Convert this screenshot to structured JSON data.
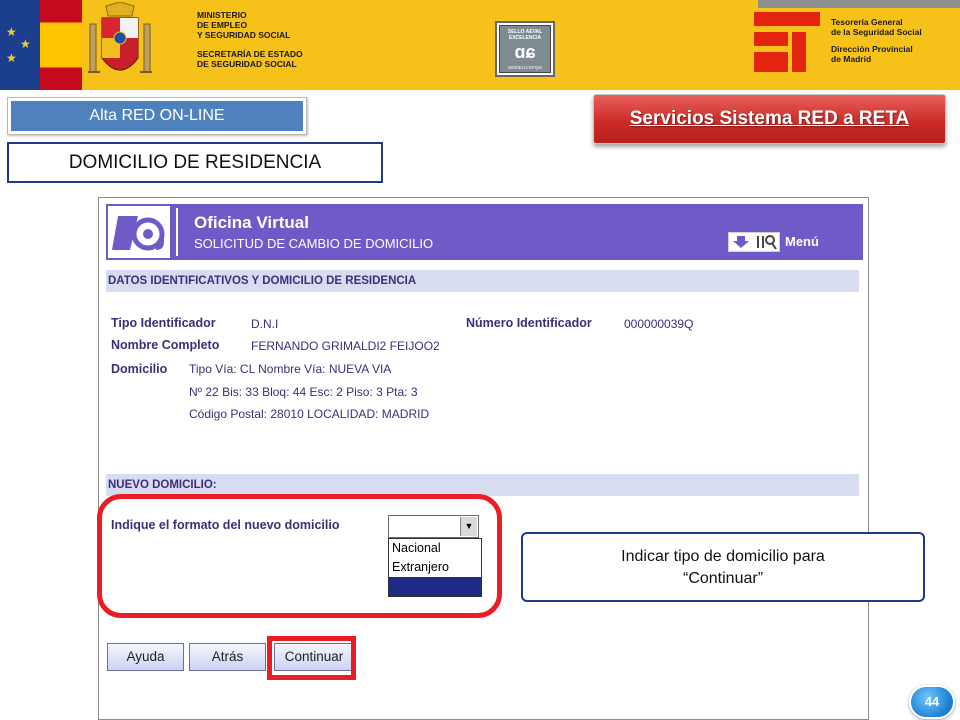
{
  "header": {
    "ministry_lines": [
      "MINISTERIO",
      "DE  EMPLEO",
      "Y SEGURIDAD SOCIAL"
    ],
    "secretaria_lines": [
      "SECRETARÍA DE ESTADO",
      "DE SEGURIDAD SOCIAL"
    ],
    "seal": {
      "top_lines": [
        "SELLO AEVAL",
        "EXCELENCIA"
      ],
      "mark": "ɑɕ",
      "bottom": "MODELO EFQM"
    },
    "tgss_lines": [
      "Tesorería General",
      "de la Seguridad Social"
    ],
    "provincial_lines": [
      "Dirección Provincial",
      "de Madrid"
    ],
    "colors": {
      "band": "#f6c21a",
      "eu_blue": "#1b3e8f",
      "tgss_red": "#e3240f"
    }
  },
  "top": {
    "alta_label": "Alta RED ON-LINE",
    "servicios_label": "Servicios Sistema RED a RETA",
    "section_title": "DOMICILIO DE RESIDENCIA"
  },
  "app": {
    "title": "Oficina Virtual",
    "subtitle": "SOLICITUD DE CAMBIO DE DOMICILIO",
    "menu_label": "Menú",
    "section1": "DATOS IDENTIFICATIVOS Y DOMICILIO DE RESIDENCIA",
    "fields": {
      "tipo_label": "Tipo Identificador",
      "tipo_value": "D.N.I",
      "numero_label": "Número Identificador",
      "numero_value": "000000039Q",
      "nombre_label": "Nombre Completo",
      "nombre_value": "FERNANDO GRIMALDI2 FEIJOO2",
      "domicilio_label": "Domicilio",
      "domicilio_lines": [
        "Tipo Vía: CL Nombre Vía: NUEVA VIA",
        "Nº 22 Bis: 33 Bloq: 44 Esc: 2 Piso: 3 Pta: 3",
        "Código Postal: 28010 LOCALIDAD: MADRID"
      ]
    },
    "section2": "NUEVO DOMICILIO:",
    "format_label": "Indique el formato del nuevo domicilio",
    "select": {
      "value": "",
      "options": [
        "Nacional",
        "Extranjero",
        ""
      ]
    },
    "buttons": {
      "ayuda": "Ayuda",
      "atras": "Atrás",
      "continuar": "Continuar"
    },
    "colors": {
      "header": "#6f5ac8",
      "section": "#d8dcf0",
      "text": "#3d2e7a"
    }
  },
  "annotation": {
    "callout_lines": [
      "Indicar tipo de domicilio para",
      "“Continuar”"
    ],
    "highlight_color": "#ec1c24"
  },
  "page_number": "44"
}
